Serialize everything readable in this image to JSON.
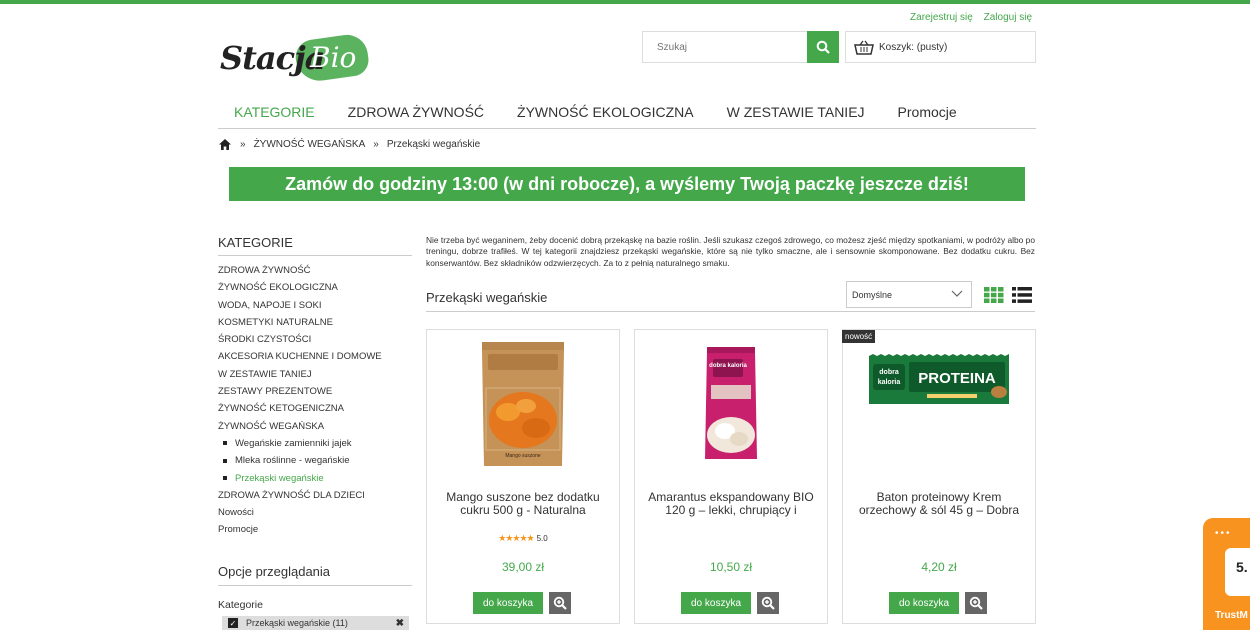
{
  "toplinks": {
    "register": "Zarejestruj się",
    "login": "Zaloguj się"
  },
  "logo": {
    "part1": "Stacja",
    "part2": "Bio"
  },
  "search": {
    "placeholder": "Szukaj"
  },
  "cart": {
    "label": "Koszyk: (pusty)"
  },
  "nav": [
    "KATEGORIE",
    "ZDROWA ŻYWNOŚĆ",
    "ŻYWNOŚĆ EKOLOGICZNA",
    "W ZESTAWIE TANIEJ",
    "Promocje"
  ],
  "breadcrumb": {
    "sep": "»",
    "level1": "ŻYWNOŚĆ WEGAŃSKA",
    "level2": "Przekąski wegańskie"
  },
  "banner": "Zamów do godziny 13:00 (w dni robocze), a wyślemy Twoją paczkę jeszcze dziś!",
  "sidebar": {
    "heading": "KATEGORIE",
    "items": [
      "ZDROWA ŻYWNOŚĆ",
      "ŻYWNOŚĆ EKOLOGICZNA",
      "WODA, NAPOJE I SOKI",
      "KOSMETYKI NATURALNE",
      "ŚRODKI CZYSTOŚCI",
      "AKCESORIA KUCHENNE I DOMOWE",
      "W ZESTAWIE TANIEJ",
      "ZESTAWY PREZENTOWE",
      "ŻYWNOŚĆ KETOGENICZNA",
      "ŻYWNOŚĆ WEGAŃSKA"
    ],
    "subitems": [
      "Wegańskie zamienniki jajek",
      "Mleka roślinne - wegańskie",
      "Przekąski wegańskie"
    ],
    "items_after": [
      "ZDROWA ŻYWNOŚĆ DLA DZIECI",
      "Nowości",
      "Promocje"
    ],
    "options_heading": "Opcje przeglądania",
    "filter_label": "Kategorie",
    "active_filter": "Przekąski wegańskie (11)",
    "remove": "✖"
  },
  "description": "Nie trzeba być weganinem, żeby docenić dobrą przekąskę na bazie roślin. Jeśli szukasz czegoś zdrowego, co możesz zjeść między spotkaniami, w podróży albo po treningu, dobrze trafiłeś. W tej kategorii znajdziesz przekąski wegańskie, które są nie tylko smaczne, ale i sensownie skomponowane. Bez dodatku cukru. Bez konserwantów. Bez składników odzwierzęcych. Za to z pełnią naturalnego smaku.",
  "listing": {
    "title": "Przekąski wegańskie",
    "sort": "Domyślne"
  },
  "products": [
    {
      "name": "Mango suszone bez dodatku cukru 500 g - Naturalna",
      "stars": "★★★★★",
      "rating": "5.0",
      "price": "39,00 zł",
      "button": "do koszyka",
      "badge": "",
      "pack_text": "Mango suszone"
    },
    {
      "name": "Amarantus ekspandowany BIO 120 g – lekki, chrupiący i",
      "stars": "",
      "rating": "",
      "price": "10,50 zł",
      "button": "do koszyka",
      "badge": "",
      "pack_text": "dobra kaloria"
    },
    {
      "name": "Baton proteinowy Krem orzechowy & sól 45 g – Dobra",
      "stars": "",
      "rating": "",
      "price": "4,20 zł",
      "button": "do koszyka",
      "badge": "nowość",
      "pack_text": "PROTEINA"
    }
  ],
  "trust": {
    "score": "5.",
    "brand": "TrustM"
  },
  "colors": {
    "accent": "#44a84b",
    "badge": "#333333",
    "trust": "#f7931e",
    "stars": "#f7941d"
  }
}
